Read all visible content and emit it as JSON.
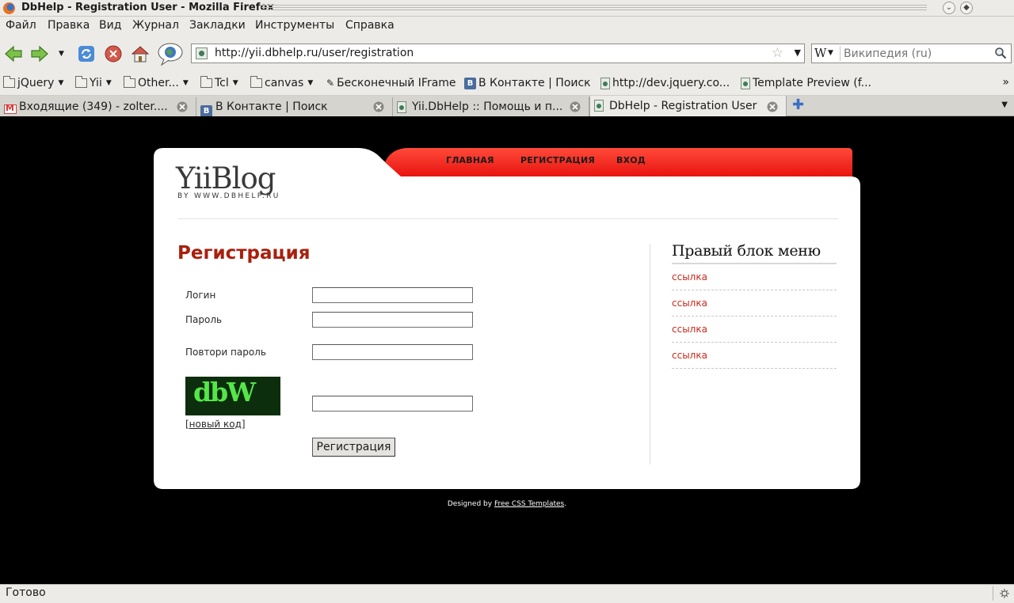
{
  "window": {
    "title": "DbHelp - Registration User - Mozilla Firefox"
  },
  "menu": [
    "Файл",
    "Правка",
    "Вид",
    "Журнал",
    "Закладки",
    "Инструменты",
    "Справка"
  ],
  "toolbar": {
    "url": "http://yii.dbhelp.ru/user/registration",
    "search_placeholder": "Википедия (ru)",
    "search_engine_letter": "W"
  },
  "bookmarks": [
    {
      "label": "jQuery",
      "kind": "folder"
    },
    {
      "label": "Yii",
      "kind": "folder"
    },
    {
      "label": "Other...",
      "kind": "folder"
    },
    {
      "label": "Tcl",
      "kind": "folder"
    },
    {
      "label": "canvas",
      "kind": "folder"
    },
    {
      "label": "Бесконечный IFrame",
      "kind": "link"
    },
    {
      "label": "В Контакте | Поиск",
      "kind": "link"
    },
    {
      "label": "http://dev.jquery.co...",
      "kind": "link"
    },
    {
      "label": "Template Preview (f...",
      "kind": "link"
    }
  ],
  "tabs": [
    {
      "label": "Входящие (349) - zolter....",
      "active": false
    },
    {
      "label": "В Контакте | Поиск",
      "active": false
    },
    {
      "label": "Yii.DbHelp :: Помощь и п...",
      "active": false
    },
    {
      "label": "DbHelp - Registration User",
      "active": true
    }
  ],
  "site": {
    "logo": "YiiBlog",
    "logo_sub": "BY WWW.DBHELP.RU",
    "nav": [
      "ГЛАВНАЯ",
      "РЕГИСТРАЦИЯ",
      "ВХОД"
    ],
    "page_title": "Регистрация",
    "form": {
      "login_label": "Логин",
      "password_label": "Пароль",
      "repeat_label": "Повтори пароль",
      "captcha_text": "dbW",
      "new_code": "[новый код]",
      "submit": "Регистрация"
    },
    "sidebar": {
      "title": "Правый блок меню",
      "links": [
        "ссылка",
        "ссылка",
        "ссылка",
        "ссылка"
      ]
    },
    "footer": {
      "prefix": "Designed by ",
      "link": "Free CSS Templates",
      "suffix": "."
    }
  },
  "status": {
    "text": "Готово"
  },
  "colors": {
    "accent_red": "#ff2b2b",
    "title_red": "#a8200d",
    "link_red": "#c9281b",
    "captcha_bg": "#0c2e0c",
    "captcha_fg": "#55e64a"
  }
}
